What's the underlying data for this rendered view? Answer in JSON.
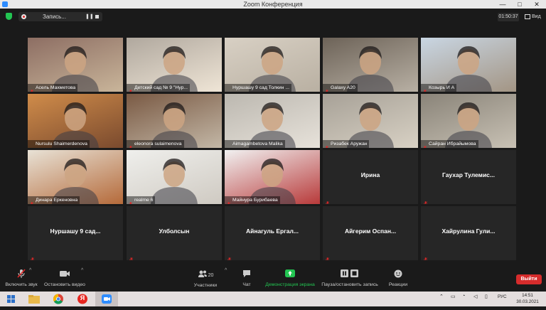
{
  "window": {
    "title": "Zoom Конференция",
    "minimize": "—",
    "maximize": "□",
    "close": "✕"
  },
  "topbar": {
    "recording_label": "Запись...",
    "pause_glyph": "❚❚",
    "timer": "01:50:37",
    "view_label": "Вид"
  },
  "participants": [
    {
      "name": "Асель Махметова",
      "video": true,
      "muted": true
    },
    {
      "name": "Детский сад № 9 \"Нур...",
      "video": true,
      "muted": true
    },
    {
      "name": "Нуршашу 9 сад Толкин ...",
      "video": true,
      "muted": false
    },
    {
      "name": "Galaxy A20",
      "video": true,
      "muted": true
    },
    {
      "name": "Козырь И А",
      "video": true,
      "muted": true
    },
    {
      "name": "Nursulu Shaimerdenova",
      "video": true,
      "muted": false,
      "active": true
    },
    {
      "name": "eleonora sulaimenova",
      "video": true,
      "muted": true
    },
    {
      "name": "Aimagambetova Malika",
      "video": true,
      "muted": false
    },
    {
      "name": "Ризабек Аружан",
      "video": true,
      "muted": true
    },
    {
      "name": "Сайран Ибрайымова",
      "video": true,
      "muted": true
    },
    {
      "name": "Динара Еркеновна",
      "video": true,
      "muted": true
    },
    {
      "name": "realme 6",
      "video": true,
      "muted": true
    },
    {
      "name": "Майнура Бурибаева",
      "video": true,
      "muted": true
    },
    {
      "name": "Ирина",
      "video": false,
      "muted": true
    },
    {
      "name": "Гаухар Тулемис...",
      "video": false,
      "muted": true
    },
    {
      "name": "Нуршашу 9 сад...",
      "video": false,
      "muted": true
    },
    {
      "name": "Улболсын",
      "video": false,
      "muted": true
    },
    {
      "name": "Айнагуль Ергал...",
      "video": false,
      "muted": true
    },
    {
      "name": "Айгерим Оспан...",
      "video": false,
      "muted": true
    },
    {
      "name": "Хайрулина Гули...",
      "video": false,
      "muted": true
    }
  ],
  "toolbar": {
    "unmute_label": "Включить звук",
    "stop_video_label": "Остановить видео",
    "participants_label": "Участники",
    "participants_count": "20",
    "chat_label": "Чат",
    "share_label": "Демонстрация экрана",
    "pause_recording_label": "Пауза/остановить запись",
    "reactions_label": "Реакции",
    "leave_label": "Выйти",
    "caret": "^"
  },
  "taskbar": {
    "lang": "РУС",
    "time": "14:51",
    "date": "30.03.2021",
    "browser_icon_letter": "Я"
  },
  "colors": {
    "share_green": "#23c552",
    "leave_red": "#d62c2c",
    "active_speaker": "#c7e34a",
    "mute_red": "#e02828"
  }
}
